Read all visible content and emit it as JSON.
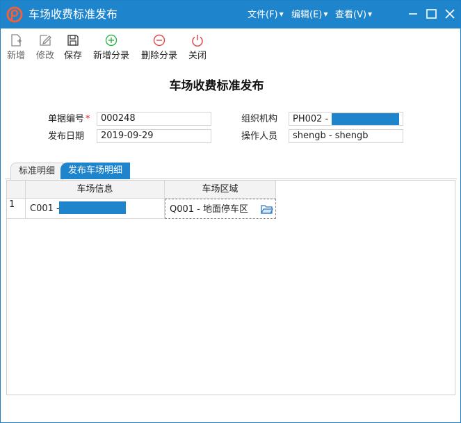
{
  "window": {
    "title": "车场收费标准发布"
  },
  "menus": [
    {
      "label": "文件(F)"
    },
    {
      "label": "编辑(E)"
    },
    {
      "label": "查看(V)"
    }
  ],
  "toolbar": {
    "add": "新增",
    "edit": "修改",
    "save": "保存",
    "add_entry": "新增分录",
    "delete_entry": "删除分录",
    "close": "关闭"
  },
  "form": {
    "title": "车场收费标准发布",
    "doc_no_label": "单据编号",
    "required_mark": "*",
    "doc_no": "000248",
    "date_label": "发布日期",
    "date": "2019-09-29",
    "org_label": "组织机构",
    "org": "PH002 -",
    "operator_label": "操作人员",
    "operator": "shengb - shengb"
  },
  "tabs": [
    {
      "label": "标准明细"
    },
    {
      "label": "发布车场明细"
    }
  ],
  "grid": {
    "columns": [
      "车场信息",
      "车场区域"
    ],
    "rows": [
      {
        "num": "1",
        "lot": "C001 -",
        "area": "Q001 - 地面停车区"
      }
    ]
  },
  "colors": {
    "accent": "#1e84cc",
    "required": "#e02020",
    "add_icon": "#2db34a",
    "delete_icon": "#e04848"
  },
  "icons": {
    "add": "new-doc-icon",
    "edit": "pencil-icon",
    "save": "floppy-icon",
    "add_entry": "plus-circle-icon",
    "delete_entry": "minus-circle-icon",
    "close": "power-icon",
    "lookup": "folder-icon"
  }
}
